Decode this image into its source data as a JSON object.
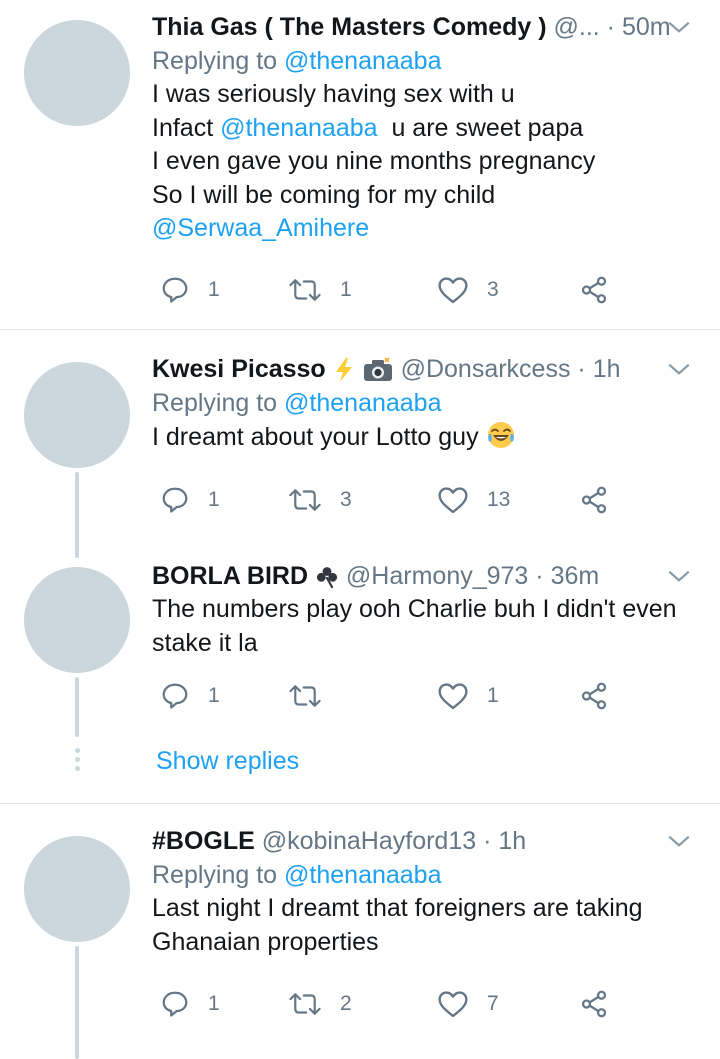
{
  "tweets": [
    {
      "name": "Thia Gas ( The Masters Comedy )",
      "handle": "@...",
      "time": "50m",
      "replying_prefix": "Replying to",
      "replying_to": "@thenanaaba",
      "lines": [
        {
          "pre": "I was seriously having sex with u",
          "mention": "",
          "post": ""
        },
        {
          "pre": "Infact ",
          "mention": "@thenanaaba",
          "post": "  u are sweet papa"
        },
        {
          "pre": "I even gave you nine months pregnancy",
          "mention": "",
          "post": ""
        },
        {
          "pre": "So I will be coming for my child",
          "mention": "",
          "post": ""
        },
        {
          "pre": "",
          "mention": "@Serwaa_Amihere",
          "post": ""
        }
      ],
      "replies": "1",
      "retweets": "1",
      "likes": "3"
    },
    {
      "name": "Kwesi Picasso",
      "name_emojis": [
        "lightning-emoji",
        "camera-emoji"
      ],
      "handle": "@Donsarkcess",
      "time": "1h",
      "replying_prefix": "Replying to",
      "replying_to": "@thenanaaba",
      "lines": [
        {
          "pre": "I dreamt about your Lotto guy ",
          "mention": "",
          "post": ""
        }
      ],
      "text_emoji": "joy-emoji",
      "replies": "1",
      "retweets": "3",
      "likes": "13"
    },
    {
      "name": "BORLA BIRD",
      "name_emojis": [
        "shamrock-emoji"
      ],
      "handle": "@Harmony_973",
      "time": "36m",
      "lines": [
        {
          "pre": "The numbers play ooh Charlie buh I didn't even",
          "mention": "",
          "post": ""
        },
        {
          "pre": "stake it la",
          "mention": "",
          "post": ""
        }
      ],
      "replies": "1",
      "retweets": "",
      "likes": "1"
    },
    {
      "name": "#BOGLE",
      "handle": "@kobinaHayford13",
      "time": "1h",
      "replying_prefix": "Replying to",
      "replying_to": "@thenanaaba",
      "lines": [
        {
          "pre": "Last night I dreamt that foreigners are taking",
          "mention": "",
          "post": ""
        },
        {
          "pre": "Ghanaian properties",
          "mention": "",
          "post": ""
        }
      ],
      "replies": "1",
      "retweets": "2",
      "likes": "7"
    }
  ],
  "show_replies_label": "Show replies",
  "separator": "·",
  "colors": {
    "text": "#14171a",
    "secondary": "#657786",
    "link": "#1da1f2",
    "avatar": "#ccd6dd",
    "divider": "#e1e8ed"
  },
  "icons": [
    "reply-icon",
    "retweet-icon",
    "like-icon",
    "share-icon",
    "chevron-down-icon"
  ]
}
